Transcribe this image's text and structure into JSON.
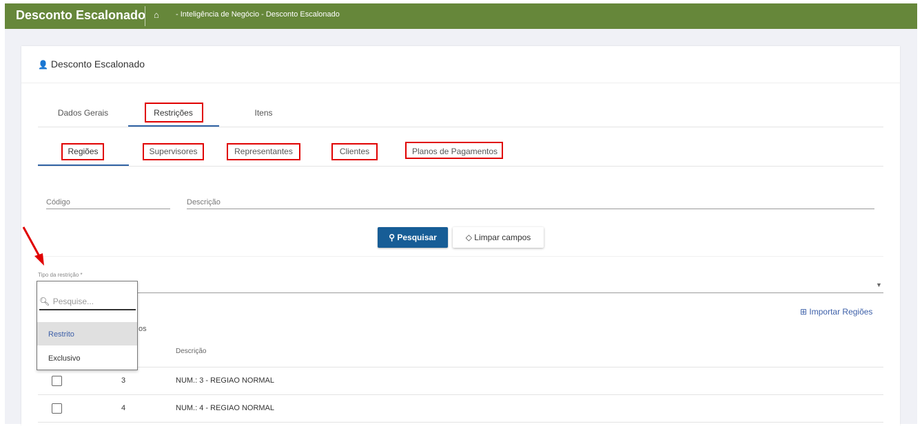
{
  "header": {
    "app_title": "Desconto Escalonado",
    "breadcrumb": "- Inteligência de Negócio - Desconto Escalonado",
    "home_icon": "⌂"
  },
  "card": {
    "title": "Desconto Escalonado"
  },
  "tabs": [
    {
      "label": "Dados Gerais"
    },
    {
      "label": "Restrições"
    },
    {
      "label": "Itens"
    }
  ],
  "subtabs": [
    {
      "label": "Regiões"
    },
    {
      "label": "Supervisores"
    },
    {
      "label": "Representantes"
    },
    {
      "label": "Clientes"
    },
    {
      "label": "Planos de Pagamentos"
    }
  ],
  "filters": {
    "codigo_label": "Código",
    "descricao_label": "Descrição"
  },
  "buttons": {
    "search": "Pesquisar",
    "clear": "Limpar campos"
  },
  "restriction": {
    "label": "Tipo da restrição *",
    "search_placeholder": "Pesquise...",
    "options": [
      "Restrito",
      "Exclusivo"
    ],
    "highlighted": "Restrito"
  },
  "import_label": "Importar Regiões",
  "hidden_fragment": "os",
  "table": {
    "header_descricao": "Descrição",
    "rows": [
      {
        "code": "3",
        "desc": "NUM.: 3 - REGIAO NORMAL"
      },
      {
        "code": "4",
        "desc": "NUM.: 4 - REGIAO NORMAL"
      }
    ]
  },
  "colors": {
    "topbar": "#66873a",
    "primary": "#175d96",
    "annotation": "#e00000"
  }
}
